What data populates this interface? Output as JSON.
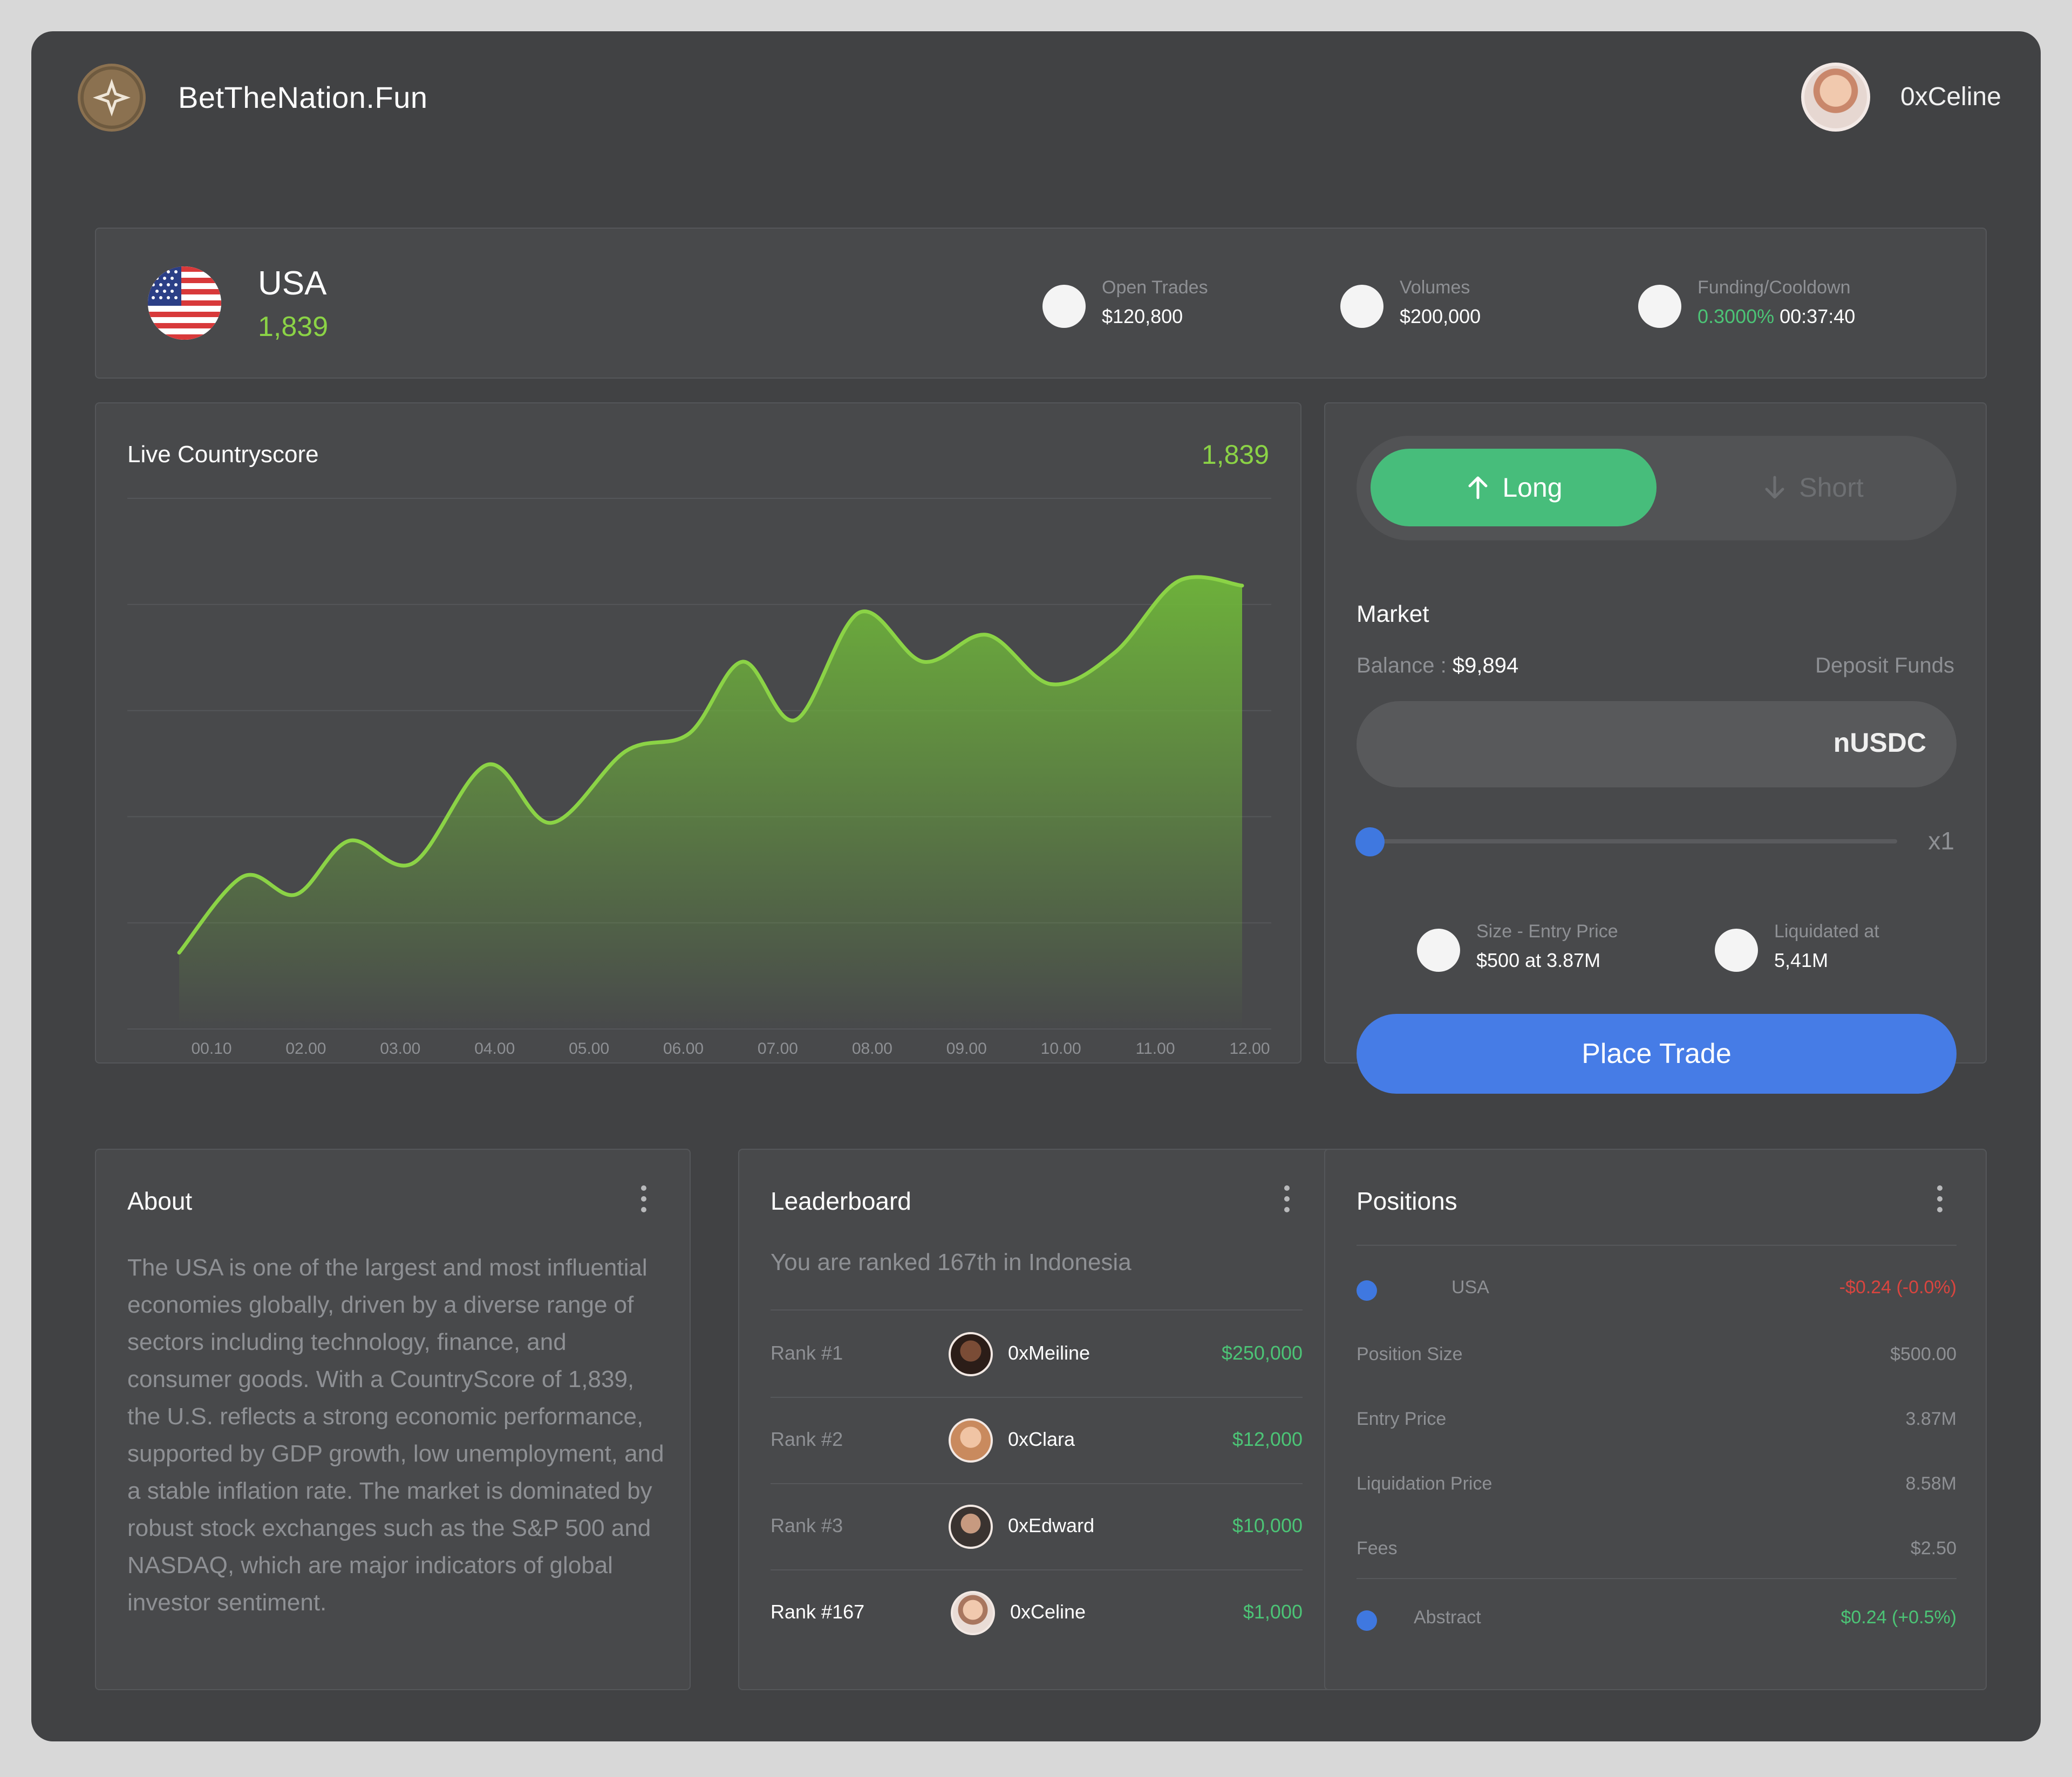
{
  "header": {
    "brand": "BetTheNation.Fun",
    "user": "0xCeline"
  },
  "country": {
    "name": "USA",
    "score": "1,839",
    "stats": [
      {
        "label": "Open Trades",
        "value": "$120,800"
      },
      {
        "label": "Volumes",
        "value": "$200,000"
      },
      {
        "label": "Funding/Cooldown",
        "value_green": "0.3000%",
        "value": "00:37:40"
      }
    ]
  },
  "chart": {
    "title": "Live Countryscore",
    "value": "1,839"
  },
  "chart_data": {
    "type": "area",
    "title": "Live Countryscore",
    "x": [
      "00.10",
      "02.00",
      "03.00",
      "04.00",
      "05.00",
      "06.00",
      "07.00",
      "08.00",
      "09.00",
      "10.00",
      "11.00",
      "12.00"
    ],
    "xlabel": "",
    "ylabel": "",
    "color": "#8bd346",
    "curve_points": [
      [
        0.0,
        0.05
      ],
      [
        0.06,
        0.22
      ],
      [
        0.11,
        0.18
      ],
      [
        0.16,
        0.3
      ],
      [
        0.22,
        0.25
      ],
      [
        0.29,
        0.47
      ],
      [
        0.35,
        0.34
      ],
      [
        0.42,
        0.5
      ],
      [
        0.48,
        0.54
      ],
      [
        0.53,
        0.7
      ],
      [
        0.58,
        0.57
      ],
      [
        0.64,
        0.81
      ],
      [
        0.7,
        0.7
      ],
      [
        0.76,
        0.76
      ],
      [
        0.82,
        0.65
      ],
      [
        0.88,
        0.72
      ],
      [
        0.94,
        0.88
      ],
      [
        1.0,
        0.87
      ]
    ]
  },
  "trade": {
    "long_label": "Long",
    "short_label": "Short",
    "market_label": "Market",
    "balance_label": "Balance :",
    "balance_value": "$9,894",
    "deposit_label": "Deposit Funds",
    "currency": "nUSDC",
    "leverage": "x1",
    "leverage_level": 0.0,
    "size_label": "Size - Entry Price",
    "size_value": "$500 at 3.87M",
    "liq_label": "Liquidated at",
    "liq_value": "5,41M",
    "place_label": "Place Trade"
  },
  "about": {
    "title": "About",
    "text": "The USA is one of the largest and most influential economies globally, driven by a diverse range of sectors including technology, finance, and consumer goods. With a CountryScore of 1,839, the U.S. reflects a strong economic performance, supported by GDP growth, low unemployment, and a stable inflation rate. The market is dominated by robust stock exchanges such as the S&P 500 and NASDAQ, which are major indicators of global investor sentiment."
  },
  "leaderboard": {
    "title": "Leaderboard",
    "subtitle": "You are ranked 167th in Indonesia",
    "rows": [
      {
        "rank": "Rank #1",
        "name": "0xMeiline",
        "amount": "$250,000"
      },
      {
        "rank": "Rank #2",
        "name": "0xClara",
        "amount": "$12,000"
      },
      {
        "rank": "Rank #3",
        "name": "0xEdward",
        "amount": "$10,000"
      },
      {
        "rank": "Rank #167",
        "name": "0xCeline",
        "amount": "$1,000"
      }
    ]
  },
  "positions": {
    "title": "Positions",
    "asset": "USA",
    "asset_pnl": "-$0.24 (-0.0%)",
    "rows": [
      {
        "label": "Position Size",
        "value": "$500.00"
      },
      {
        "label": "Entry Price",
        "value": "3.87M"
      },
      {
        "label": "Liquidation Price",
        "value": "8.58M"
      },
      {
        "label": "Fees",
        "value": "$2.50"
      }
    ],
    "footer_asset": "Abstract",
    "footer_pnl": "$0.24 (+0.5%)"
  }
}
